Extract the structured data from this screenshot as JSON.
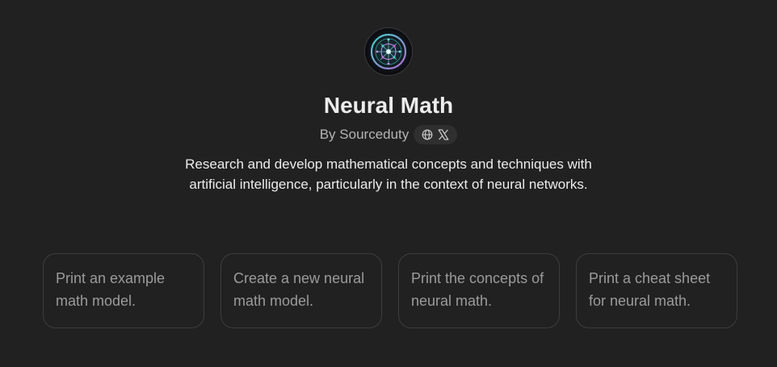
{
  "gpt": {
    "name": "Neural Math",
    "byline": "By Sourceduty",
    "description": "Research and develop mathematical concepts and techniques with artificial intelligence, particularly in the context of neural networks."
  },
  "social_links": [
    {
      "icon": "globe-icon"
    },
    {
      "icon": "x-logo-icon"
    }
  ],
  "conversation_starters": [
    {
      "label": "Print an example math model."
    },
    {
      "label": "Create a new neural math model."
    },
    {
      "label": "Print the concepts of neural math."
    },
    {
      "label": "Print a cheat sheet for neural math."
    }
  ],
  "colors": {
    "background": "#212121",
    "text_primary": "#ececec",
    "text_secondary": "#b4b4b4",
    "starter_text": "#9b9b9b",
    "starter_border": "#3d3d3d",
    "pill_background": "#2f2f2f",
    "avatar_accent_teal": "#3fd3c7",
    "avatar_accent_purple": "#b86bd8"
  }
}
